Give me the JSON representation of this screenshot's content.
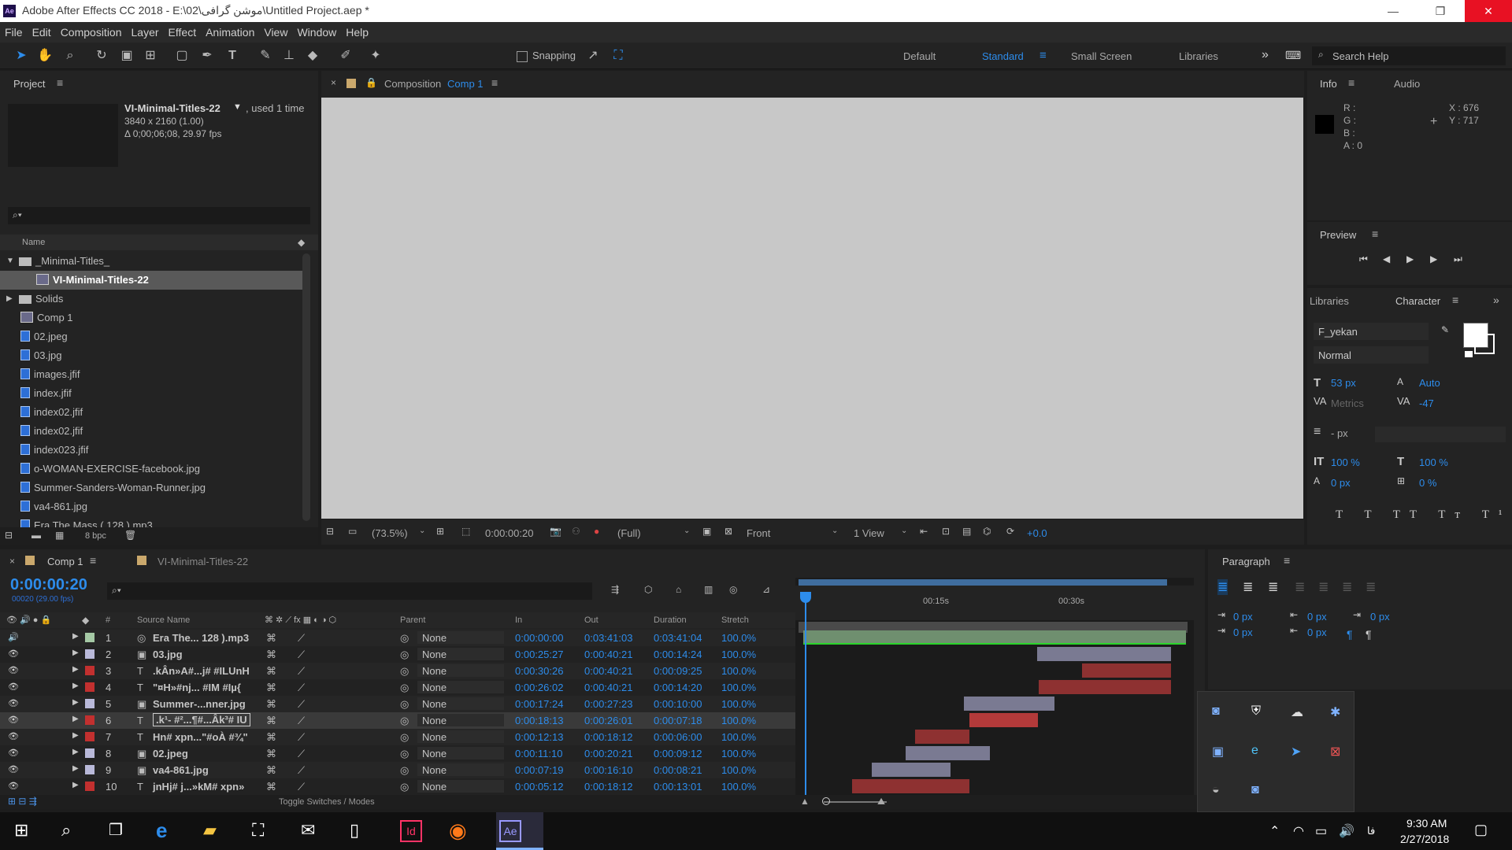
{
  "app": {
    "title": "Adobe After Effects CC 2018 - E:\\02\\موشن گرافی\\Untitled Project.aep *",
    "logo": "Ae",
    "window_buttons": {
      "minimize": "—",
      "maximize": "❐",
      "close": "✕"
    }
  },
  "menu": [
    "File",
    "Edit",
    "Composition",
    "Layer",
    "Effect",
    "Animation",
    "View",
    "Window",
    "Help"
  ],
  "toolbar": {
    "snapping_label": "Snapping",
    "workspaces": [
      "Default",
      "Standard",
      "Small Screen",
      "Libraries"
    ],
    "active_workspace": "Standard",
    "more": "»",
    "search_placeholder": "Search Help"
  },
  "project": {
    "tab": "Project",
    "selected_name": "VI-Minimal-Titles-22",
    "used": ", used 1 time",
    "resolution": "3840 x 2160 (1.00)",
    "duration": "Δ 0;00;06;08, 29.97 fps",
    "search_placeholder": "",
    "col_name": "Name",
    "items": [
      {
        "name": "_Minimal-Titles_",
        "kind": "folder",
        "expanded": true
      },
      {
        "name": "VI-Minimal-Titles-22",
        "kind": "comp",
        "indent": true,
        "selected": true
      },
      {
        "name": "Solids",
        "kind": "folder",
        "expanded": false
      },
      {
        "name": "Comp 1",
        "kind": "comp"
      },
      {
        "name": "02.jpeg",
        "kind": "file"
      },
      {
        "name": "03.jpg",
        "kind": "file"
      },
      {
        "name": "images.jfif",
        "kind": "file"
      },
      {
        "name": "index.jfif",
        "kind": "file"
      },
      {
        "name": "index02.jfif",
        "kind": "file"
      },
      {
        "name": "index02.jfif",
        "kind": "file"
      },
      {
        "name": "index023.jfif",
        "kind": "file"
      },
      {
        "name": "o-WOMAN-EXERCISE-facebook.jpg",
        "kind": "file"
      },
      {
        "name": "Summer-Sanders-Woman-Runner.jpg",
        "kind": "file"
      },
      {
        "name": "va4-861.jpg",
        "kind": "file"
      },
      {
        "name": "Era The Mass ( 128 ).mp3",
        "kind": "file"
      }
    ],
    "bpc": "8 bpc"
  },
  "composition": {
    "tab_prefix": "Composition",
    "tab_name": "Comp 1",
    "zoom": "(73.5%)",
    "timecode": "0:00:00:20",
    "resolution": "(Full)",
    "view": "Front",
    "views": "1 View",
    "exposure": "+0.0"
  },
  "info": {
    "tab": "Info",
    "tab2": "Audio",
    "r": "R :",
    "g": "G :",
    "b": "B :",
    "a": "A :  0",
    "x": "X : 676",
    "y": "Y : 717"
  },
  "preview": {
    "tab": "Preview"
  },
  "character": {
    "tab_libraries": "Libraries",
    "tab": "Character",
    "font": "F_yekan",
    "style": "Normal",
    "size": "53 px",
    "leading": "Auto",
    "kerning": "Metrics",
    "tracking": "-47",
    "stroke": "- px",
    "vscale": "100 %",
    "hscale": "100 %",
    "baseline": "0 px",
    "tsume": "0 %"
  },
  "paragraph": {
    "tab": "Paragraph",
    "indent_left": "0 px",
    "indent_right": "0 px",
    "indent_first": "0 px",
    "space_before": "0 px",
    "space_after": "0 px"
  },
  "timeline": {
    "tab_comp": "Comp 1",
    "tab_other": "VI-Minimal-Titles-22",
    "timecode": "0:00:00:20",
    "timecode_sub": "00020 (29.00 fps)",
    "headers": {
      "num": "#",
      "source": "Source Name",
      "parent": "Parent",
      "in": "In",
      "out": "Out",
      "duration": "Duration",
      "stretch": "Stretch"
    },
    "ruler": [
      "00:15s",
      "00:30s"
    ],
    "toggle": "Toggle Switches / Modes",
    "layers": [
      {
        "n": "1",
        "name": "Era The... 128 ).mp3",
        "color": "#a5c9a5",
        "type": "audio",
        "in": "0:00:00:00",
        "out": "0:03:41:03",
        "dur": "0:03:41:04",
        "stretch": "100.0%",
        "parent": "None",
        "bar_start": 0,
        "bar_end": 221.1,
        "bar_color": "#6f8f6f"
      },
      {
        "n": "2",
        "name": "03.jpg",
        "color": "#b9b9d9",
        "type": "file",
        "in": "0:00:25:27",
        "out": "0:00:40:21",
        "dur": "0:00:14:24",
        "stretch": "100.0%",
        "parent": "None",
        "bar_start": 25.9,
        "bar_end": 40.7,
        "bar_color": "#7a7a92"
      },
      {
        "n": "3",
        "name": ".kÂn»A#...j# #ILUnH",
        "color": "#c2302f",
        "type": "text",
        "in": "0:00:30:26",
        "out": "0:00:40:21",
        "dur": "0:00:09:25",
        "stretch": "100.0%",
        "parent": "None",
        "bar_start": 30.9,
        "bar_end": 40.7,
        "bar_color": "#8e3131"
      },
      {
        "n": "4",
        "name": "\"¤H»#nj... #IM #Iµ{",
        "color": "#c2302f",
        "type": "text",
        "in": "0:00:26:02",
        "out": "0:00:40:21",
        "dur": "0:00:14:20",
        "stretch": "100.0%",
        "parent": "None",
        "bar_start": 26.1,
        "bar_end": 40.7,
        "bar_color": "#8e3131"
      },
      {
        "n": "5",
        "name": "Summer-...nner.jpg",
        "color": "#b9b9d9",
        "type": "file",
        "in": "0:00:17:24",
        "out": "0:00:27:23",
        "dur": "0:00:10:00",
        "stretch": "100.0%",
        "parent": "None",
        "bar_start": 17.8,
        "bar_end": 27.8,
        "bar_color": "#7a7a92"
      },
      {
        "n": "6",
        "name": ".k¹- #²...¶#...Âk³# IU",
        "color": "#c2302f",
        "type": "text",
        "in": "0:00:18:13",
        "out": "0:00:26:01",
        "dur": "0:00:07:18",
        "stretch": "100.0%",
        "parent": "None",
        "bar_start": 18.4,
        "bar_end": 26.0,
        "bar_color": "#b33a3a",
        "selected": true
      },
      {
        "n": "7",
        "name": "Hn# xpn...\"#oÀ #¾\"",
        "color": "#c2302f",
        "type": "text",
        "in": "0:00:12:13",
        "out": "0:00:18:12",
        "dur": "0:00:06:00",
        "stretch": "100.0%",
        "parent": "None",
        "bar_start": 12.4,
        "bar_end": 18.4,
        "bar_color": "#8e3131"
      },
      {
        "n": "8",
        "name": "02.jpeg",
        "color": "#b9b9d9",
        "type": "file",
        "in": "0:00:11:10",
        "out": "0:00:20:21",
        "dur": "0:00:09:12",
        "stretch": "100.0%",
        "parent": "None",
        "bar_start": 11.3,
        "bar_end": 20.7,
        "bar_color": "#7a7a92"
      },
      {
        "n": "9",
        "name": "va4-861.jpg",
        "color": "#b9b9d9",
        "type": "file",
        "in": "0:00:07:19",
        "out": "0:00:16:10",
        "dur": "0:00:08:21",
        "stretch": "100.0%",
        "parent": "None",
        "bar_start": 7.6,
        "bar_end": 16.3,
        "bar_color": "#7a7a92"
      },
      {
        "n": "10",
        "name": "jnHj# j...»kM# xpn»",
        "color": "#c2302f",
        "type": "text",
        "in": "0:00:05:12",
        "out": "0:00:18:12",
        "dur": "0:00:13:01",
        "stretch": "100.0%",
        "parent": "None",
        "bar_start": 5.4,
        "bar_end": 18.4,
        "bar_color": "#8e3131"
      }
    ]
  },
  "taskbar": {
    "time": "9:30 AM",
    "date": "2/27/2018",
    "lang": "فا",
    "apps": [
      "start-icon",
      "search-icon",
      "task-view-icon",
      "edge-icon",
      "file-explorer-icon",
      "store-icon",
      "mail-icon",
      "document-icon",
      "indesign-icon",
      "firefox-icon",
      "after-effects-icon"
    ],
    "id_label": "Id",
    "ae_label": "Ae"
  },
  "colors": {
    "accent": "#2d8ceb",
    "panel": "#232323",
    "bg": "#1d1d1d",
    "comp_bg": "#c8c8c8"
  }
}
